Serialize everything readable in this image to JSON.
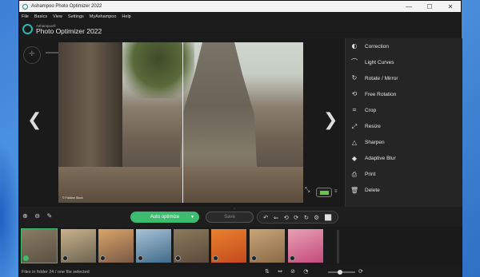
{
  "window": {
    "title": "Ashampoo Photo Optimizer 2022",
    "controls": {
      "minimize": "—",
      "maximize": "☐",
      "close": "✕"
    }
  },
  "menu": [
    "File",
    "Basics",
    "View",
    "Settings",
    "MyAshampoo",
    "Help"
  ],
  "brand": {
    "line1": "Ashampoo®",
    "line2": "Photo Optimizer 2022"
  },
  "viewer": {
    "prev_arrow": "❮",
    "next_arrow": "❯",
    "photo_credit": "© Fotoline Stock",
    "compare_icon": "⤡",
    "battery_menu": "≡"
  },
  "tools": [
    {
      "icon": "correction-icon",
      "glyph": "◐",
      "label": "Correction"
    },
    {
      "icon": "light-curves-icon",
      "glyph": "⌒",
      "label": "Light Curves"
    },
    {
      "icon": "rotate-mirror-icon",
      "glyph": "↻",
      "label": "Rotate / Mirror"
    },
    {
      "icon": "free-rotation-icon",
      "glyph": "⟲",
      "label": "Free Rotation"
    },
    {
      "icon": "crop-icon",
      "glyph": "⌗",
      "label": "Crop"
    },
    {
      "icon": "resize-icon",
      "glyph": "⤢",
      "label": "Resize"
    },
    {
      "icon": "sharpen-icon",
      "glyph": "△",
      "label": "Sharpen"
    },
    {
      "icon": "adaptive-blur-icon",
      "glyph": "◆",
      "label": "Adaptive Blur"
    },
    {
      "icon": "print-icon",
      "glyph": "⎙",
      "label": "Print"
    },
    {
      "icon": "delete-icon",
      "glyph": "🗑",
      "label": "Delete"
    }
  ],
  "toolbar": {
    "left_icons": "⊕ ⊖ ✎",
    "auto_optimize": "Auto optimize",
    "auto_caret": "▼",
    "save": "Save",
    "row_toggle": "^",
    "undo_icons": [
      "↶",
      "⇐",
      "⟲",
      "⟳",
      "↻",
      "⚙",
      "⬜"
    ]
  },
  "filmstrip": {
    "thumb_colors": [
      [
        "#5a5040",
        "#8a7d66"
      ],
      [
        "#6c6452",
        "#c9b28c"
      ],
      [
        "#7a5a44",
        "#d9a36a"
      ],
      [
        "#3f6b8a",
        "#a9c2d6"
      ],
      [
        "#5b4a3a",
        "#8a7a5e"
      ],
      [
        "#c4491d",
        "#e8822f"
      ],
      [
        "#8a6a46",
        "#c9a478"
      ],
      [
        "#c44a7a",
        "#e8a0b6"
      ]
    ]
  },
  "status": {
    "text": "Files in folder 24 / one file selected",
    "icons": "⇅ ⇔ ⊘ ◔",
    "right_icon": "⟳"
  }
}
